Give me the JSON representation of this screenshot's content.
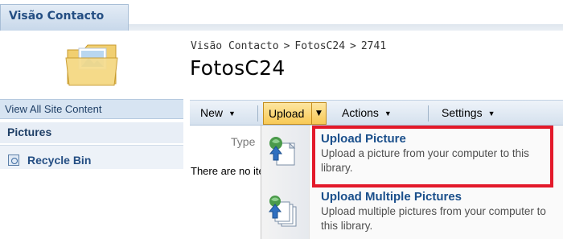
{
  "site_tab": {
    "label": "Visão Contacto"
  },
  "breadcrumb": {
    "items": [
      "Visão Contacto",
      "FotosC24",
      "2741"
    ],
    "separator": ">"
  },
  "page_title": "FotosC24",
  "nav": {
    "view_all": "View All Site Content",
    "heading": "Pictures",
    "recycle_bin": "Recycle Bin"
  },
  "toolbar": {
    "new_label": "New",
    "upload_label": "Upload",
    "actions_label": "Actions",
    "settings_label": "Settings"
  },
  "list": {
    "type_header": "Type",
    "empty_message": "There are no items to show"
  },
  "upload_menu": {
    "items": [
      {
        "title": "Upload Picture",
        "description": "Upload a picture from your computer to this library.",
        "icon": "upload-picture-icon"
      },
      {
        "title": "Upload Multiple Pictures",
        "description": "Upload multiple pictures from your computer to this library.",
        "icon": "upload-multiple-pictures-icon"
      }
    ],
    "highlight_color": "#e3192a"
  },
  "colors": {
    "link": "#1a4f8b",
    "toolbar_active": "#f8c955"
  }
}
